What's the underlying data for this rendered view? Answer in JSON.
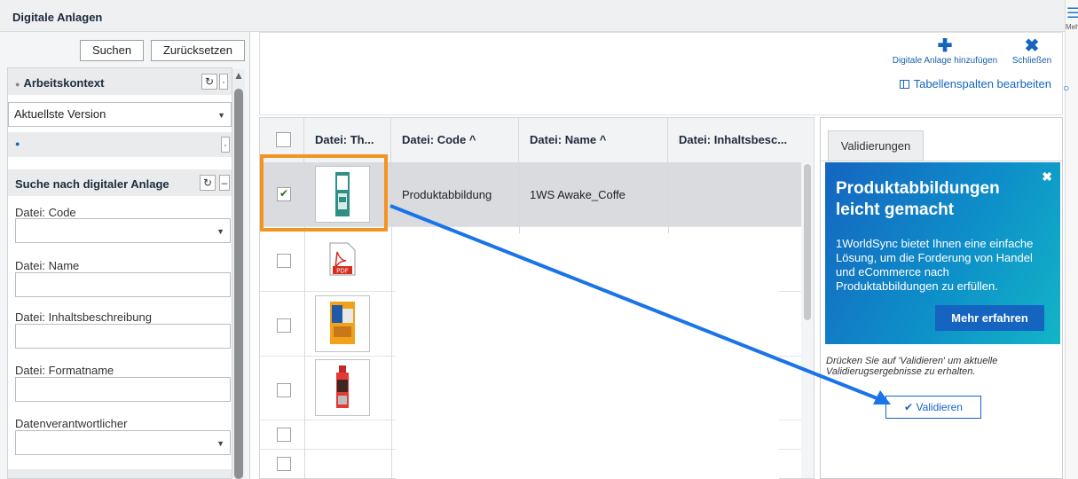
{
  "window": {
    "title": "Digitale Anlagen"
  },
  "edge": {
    "more_label": "Meh"
  },
  "search_panel": {
    "search_button": "Suchen",
    "reset_button": "Zurücksetzen",
    "work_context": {
      "title": "Arbeitskontext",
      "version_select": "Aktuellste Version"
    },
    "search_section": {
      "title": "Suche nach digitaler Anlage",
      "fields": [
        {
          "label": "Datei: Code",
          "type": "select"
        },
        {
          "label": "Datei: Name",
          "type": "text"
        },
        {
          "label": "Datei: Inhaltsbeschreibung",
          "type": "text"
        },
        {
          "label": "Datei: Formatname",
          "type": "text"
        },
        {
          "label": "Datenverantwortlicher",
          "type": "select"
        }
      ]
    }
  },
  "toolbar": {
    "add_label": "Digitale Anlage hinzufügen",
    "close_label": "Schließen",
    "edit_columns_label": "Tabellenspalten bearbeiten"
  },
  "table": {
    "columns": [
      "Datei: Th...",
      "Datei: Code ^",
      "Datei: Name ^",
      "Datei: Inhaltsbesc..."
    ],
    "rows": [
      {
        "selected": true,
        "thumbnail": "product-package",
        "code": "Produktabbildung",
        "name": "1WS Awake_Coffe",
        "description": ""
      },
      {
        "selected": false,
        "thumbnail": "pdf-file",
        "code": "",
        "name": "",
        "description": ""
      },
      {
        "selected": false,
        "thumbnail": "product-box",
        "code": "",
        "name": "",
        "description": ""
      },
      {
        "selected": false,
        "thumbnail": "product-bottle",
        "code": "",
        "name": "",
        "description": ""
      },
      {
        "selected": false,
        "thumbnail": "",
        "code": "",
        "name": "",
        "description": ""
      },
      {
        "selected": false,
        "thumbnail": "",
        "code": "",
        "name": "",
        "description": ""
      }
    ]
  },
  "validation_panel": {
    "tab_label": "Validierungen",
    "promo": {
      "title": "Produktabbildungen leicht gemacht",
      "text": "1WorldSync bietet Ihnen eine einfache Lösung, um die Forderung von Handel und eCommerce nach Produktabbildungen zu erfüllen.",
      "button": "Mehr erfahren"
    },
    "hint": "Drücken Sie auf 'Validieren' um aktuelle Validierugsergebnisse zu erhalten.",
    "validate_button": "Validieren"
  },
  "colors": {
    "accent": "#1565c0",
    "highlight_orange": "#f39322",
    "arrow_blue": "#1a73e8",
    "promo_gradient": [
      "#1565c0",
      "#12b5c6"
    ]
  }
}
